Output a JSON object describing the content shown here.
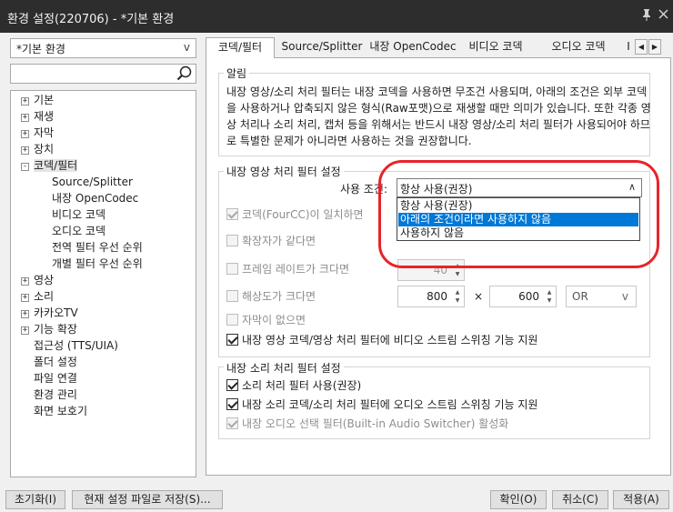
{
  "window": {
    "title": "환경 설정(220706) - *기본 환경",
    "pin_icon": "pin-icon",
    "close_icon": "close-icon"
  },
  "left": {
    "preset": "*기본 환경",
    "preset_arrow": "v",
    "search_placeholder": "",
    "tree": [
      {
        "label": "기본",
        "expander": "+"
      },
      {
        "label": "재생",
        "expander": "+"
      },
      {
        "label": "자막",
        "expander": "+"
      },
      {
        "label": "장치",
        "expander": "+"
      },
      {
        "label": "코덱/필터",
        "expander": "-"
      },
      {
        "label": "Source/Splitter",
        "expander": ""
      },
      {
        "label": "내장 OpenCodec",
        "expander": ""
      },
      {
        "label": "비디오 코덱",
        "expander": ""
      },
      {
        "label": "오디오 코덱",
        "expander": ""
      },
      {
        "label": "전역 필터 우선 순위",
        "expander": ""
      },
      {
        "label": "개별 필터 우선 순위",
        "expander": ""
      },
      {
        "label": "영상",
        "expander": "+"
      },
      {
        "label": "소리",
        "expander": "+"
      },
      {
        "label": "카카오TV",
        "expander": "+"
      },
      {
        "label": "기능 확장",
        "expander": "+"
      },
      {
        "label": "접근성 (TTS/UIA)",
        "expander": ""
      },
      {
        "label": "폴더 설정",
        "expander": ""
      },
      {
        "label": "파일 연결",
        "expander": ""
      },
      {
        "label": "환경 관리",
        "expander": ""
      },
      {
        "label": "화면 보호기",
        "expander": ""
      }
    ]
  },
  "tabs": [
    "코덱/필터",
    "Source/Splitter",
    "내장 OpenCodec",
    "비디오 코덱",
    "오디오 코덱",
    "I"
  ],
  "tab_scroll": {
    "left": "◀",
    "right": "▶"
  },
  "notice": {
    "title": "알림",
    "text": "내장 영상/소리 처리 필터는 내장 코덱을 사용하면 무조건 사용되며, 아래의 조건은 외부 코덱을 사용하거나 압축되지 않은 형식(Raw포맷)으로 재생할 때만 의미가 있습니다. 또한 각종 영상 처리나 소리 처리, 캡처 등을 위해서는 반드시 내장 영상/소리 처리 필터가 사용되어야 하므로 특별한 문제가 아니라면 사용하는 것을 권장합니다."
  },
  "video_filter": {
    "title": "내장 영상 처리 필터 설정",
    "usage_label": "사용 조건:",
    "usage_value": "항상 사용(권장)",
    "usage_arrow": "∧",
    "options": [
      "항상 사용(권장)",
      "아래의 조건이라면 사용하지 않음",
      "사용하지 않음"
    ],
    "highlighted_option": 1,
    "fourcc_label": "코덱(FourCC)이 일치하면",
    "ext_label": "확장자가 같다면",
    "framerate_label": "프레임 레이트가 크다면",
    "framerate_value": "40",
    "resolution_label": "해상도가 크다면",
    "res_width": "800",
    "res_times": "×",
    "res_height": "600",
    "res_logic": "OR",
    "res_logic_arrow": "v",
    "no_subtitle_label": "자막이 없으면",
    "stream_switch_label": "내장 영상 코덱/영상 처리 필터에 비디오 스트림 스위칭 기능 지원"
  },
  "audio_filter": {
    "title": "내장 소리 처리 필터 설정",
    "use_label": "소리 처리 필터 사용(권장)",
    "stream_switch_label": "내장 소리 코덱/소리 처리 필터에 오디오 스트림 스위칭 기능 지원",
    "audio_switcher_label": "내장 오디오 선택 필터(Built-in Audio Switcher) 활성화"
  },
  "buttons": {
    "reset": "초기화(I)",
    "save_current": "현재 설정 파일로 저장(S)...",
    "ok": "확인(O)",
    "cancel": "취소(C)",
    "apply": "적용(A)"
  },
  "colors": {
    "highlight": "#0078d7",
    "annotation": "#e8232a",
    "titlebar": "#2d2d2d"
  }
}
